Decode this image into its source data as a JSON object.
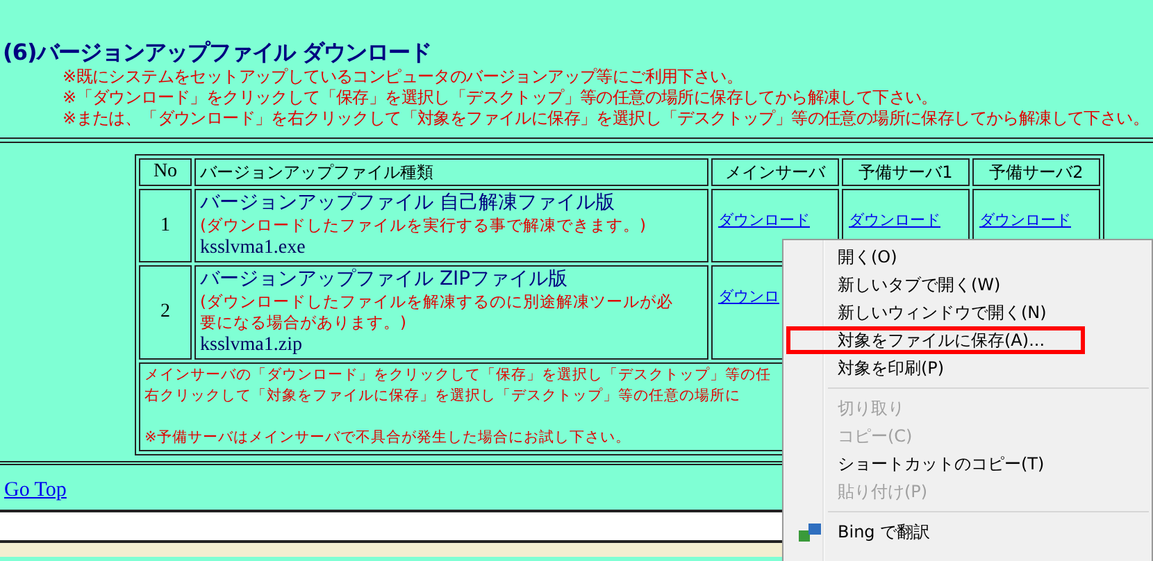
{
  "heading": "(6)バージョンアップファイル ダウンロード",
  "notes": [
    "※既にシステムをセットアップしているコンピュータのバージョンアップ等にご利用下さい。",
    "※「ダウンロード」をクリックして「保存」を選択し「デスクトップ」等の任意の場所に保存してから解凍して下さい。",
    "※または、「ダウンロード」を右クリックして「対象をファイルに保存」を選択し「デスクトップ」等の任意の場所に保存してから解凍して下さい。"
  ],
  "table": {
    "columns": [
      "No",
      "バージョンアップファイル種類",
      "メインサーバ",
      "予備サーバ1",
      "予備サーバ2"
    ],
    "rows": [
      {
        "no": "1",
        "title": "バージョンアップファイル 自己解凍ファイル版",
        "description": "(ダウンロードしたファイルを実行する事で解凍できます。)",
        "filename": "ksslvma1.exe",
        "links": [
          "ダウンロード",
          "ダウンロード",
          "ダウンロード"
        ]
      },
      {
        "no": "2",
        "title": "バージョンアップファイル ZIPファイル版",
        "description": "(ダウンロードしたファイルを解凍するのに別途解凍ツールが必要になる場合があります。)",
        "filename": "ksslvma1.zip",
        "links": [
          "ダウンロ"
        ]
      }
    ],
    "footer_lines": [
      "メインサーバの「ダウンロード」をクリックして「保存」を選択し「デスクトップ」等の任",
      "右クリックして「対象をファイルに保存」を選択し「デスクトップ」等の任意の場所に"
    ],
    "footer_note": "※予備サーバはメインサーバで不具合が発生した場合にお試し下さい。"
  },
  "go_top": "Go Top",
  "context_menu": [
    {
      "kind": "item",
      "label": "開く(O)",
      "disabled": false,
      "selected": false
    },
    {
      "kind": "item",
      "label": "新しいタブで開く(W)",
      "disabled": false,
      "selected": false
    },
    {
      "kind": "item",
      "label": "新しいウィンドウで開く(N)",
      "disabled": false,
      "selected": false
    },
    {
      "kind": "item",
      "label": "対象をファイルに保存(A)...",
      "disabled": false,
      "selected": true
    },
    {
      "kind": "item",
      "label": "対象を印刷(P)",
      "disabled": false,
      "selected": false
    },
    {
      "kind": "separator"
    },
    {
      "kind": "item",
      "label": "切り取り",
      "disabled": true,
      "selected": false
    },
    {
      "kind": "item",
      "label": "コピー(C)",
      "disabled": true,
      "selected": false
    },
    {
      "kind": "item",
      "label": "ショートカットのコピー(T)",
      "disabled": false,
      "selected": false
    },
    {
      "kind": "item",
      "label": "貼り付け(P)",
      "disabled": true,
      "selected": false
    },
    {
      "kind": "separator"
    },
    {
      "kind": "translate",
      "label": "Bing で翻訳",
      "disabled": false,
      "selected": false
    }
  ]
}
